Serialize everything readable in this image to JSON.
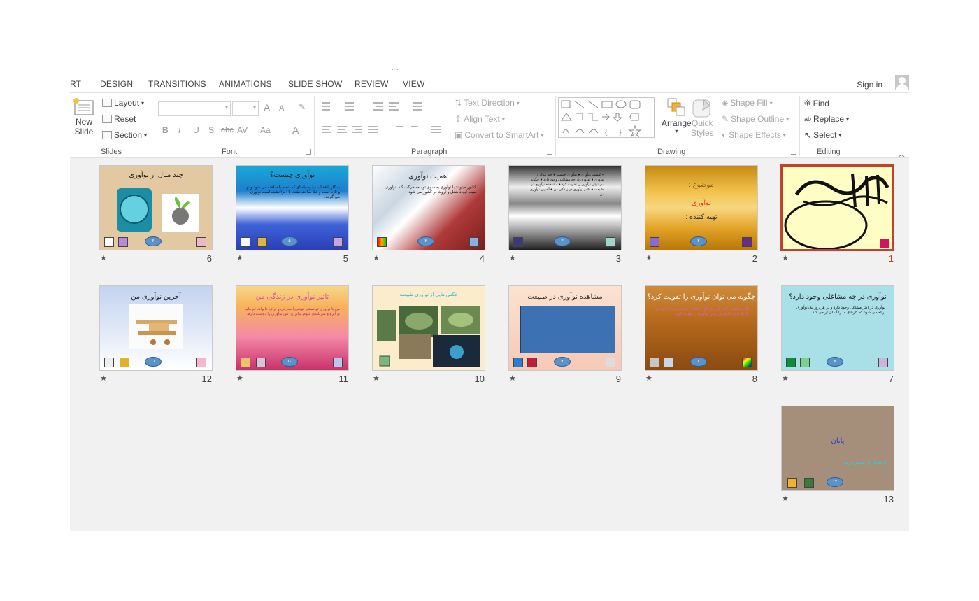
{
  "window": {
    "title": "...."
  },
  "tabs": [
    "RT",
    "DESIGN",
    "TRANSITIONS",
    "ANIMATIONS",
    "SLIDE SHOW",
    "REVIEW",
    "VIEW"
  ],
  "account": {
    "sign_in": "Sign in"
  },
  "ribbon": {
    "slides": {
      "new_slide": "New",
      "new_slide_2": "Slide",
      "layout": "Layout",
      "reset": "Reset",
      "section": "Section",
      "label": "Slides"
    },
    "font": {
      "label": "Font",
      "bold": "B",
      "italic": "I",
      "underline": "U",
      "shadow": "S",
      "strike": "abc",
      "spacing": "AV",
      "case": "Aa",
      "color": "A",
      "grow": "A",
      "shrink": "A"
    },
    "paragraph": {
      "label": "Paragraph",
      "text_direction": "Text Direction",
      "align_text": "Align Text",
      "convert_smartart": "Convert to SmartArt"
    },
    "drawing": {
      "label": "Drawing",
      "arrange": "Arrange",
      "quick_styles": "Quick",
      "quick_styles_2": "Styles",
      "shape_fill": "Shape Fill",
      "shape_outline": "Shape Outline",
      "shape_effects": "Shape Effects"
    },
    "editing": {
      "label": "Editing",
      "find": "Find",
      "replace": "Replace",
      "select": "Select"
    }
  },
  "slides": [
    {
      "num": "1",
      "title": "",
      "selected": true
    },
    {
      "num": "2",
      "title": "موضوع :",
      "sub1": "نوآوری",
      "sub2": "تهیه کننده :"
    },
    {
      "num": "3",
      "title": "فهرست مطالب",
      "badge": "۳"
    },
    {
      "num": "4",
      "title": "اهمیت نوآوری",
      "badge": "۲"
    },
    {
      "num": "5",
      "title": "نوآوری چیست؟",
      "badge": "۵"
    },
    {
      "num": "6",
      "title": "چند مثال از نوآوری",
      "badge": "۶"
    },
    {
      "num": "7",
      "title": "نوآوری در چه مشاغلی وجود دارد؟",
      "badge": "۷"
    },
    {
      "num": "8",
      "title": "چگونه می توان نوآوری را تقویت کرد؟",
      "badge": "۸"
    },
    {
      "num": "9",
      "title": "مشاهده نوآوری در طبیعت",
      "badge": "۹"
    },
    {
      "num": "10",
      "title": "عکس هایی از نوآوری طبیعت"
    },
    {
      "num": "11",
      "title": "تاثیر نوآوری در زندگی من",
      "badge": "۱۰"
    },
    {
      "num": "12",
      "title": "آخرین نوآوری من",
      "badge": "۱۱"
    },
    {
      "num": "13",
      "title": "پایان",
      "sub1": "با تشکر از معلم عزیز",
      "badge": "۱۲"
    }
  ],
  "star_glyph": "★"
}
